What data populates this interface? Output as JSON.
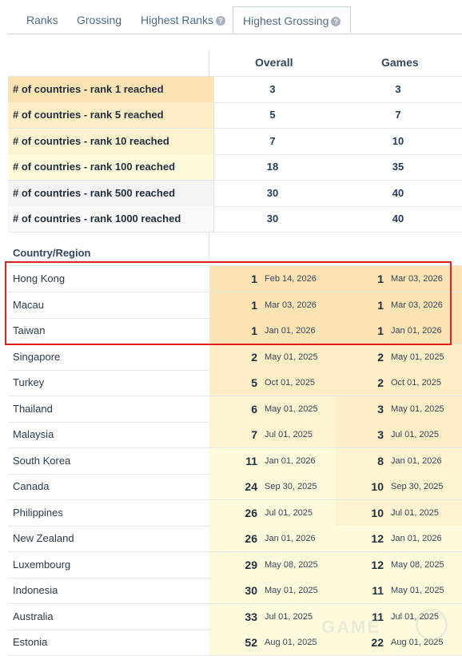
{
  "tabs": [
    {
      "label": "Ranks",
      "help": false,
      "active": false
    },
    {
      "label": "Grossing",
      "help": false,
      "active": false
    },
    {
      "label": "Highest Ranks",
      "help": true,
      "active": false
    },
    {
      "label": "Highest Grossing",
      "help": true,
      "active": true
    }
  ],
  "columns": {
    "overall": "Overall",
    "games": "Games"
  },
  "summary": [
    {
      "label": "# of countries - rank 1 reached",
      "overall": "3",
      "games": "3",
      "color": "#fce3b4"
    },
    {
      "label": "# of countries - rank 5 reached",
      "overall": "5",
      "games": "7",
      "color": "#fdeec6"
    },
    {
      "label": "# of countries - rank 10 reached",
      "overall": "7",
      "games": "10",
      "color": "#fdf3d0"
    },
    {
      "label": "# of countries - rank 100 reached",
      "overall": "18",
      "games": "35",
      "color": "#fefbdc"
    },
    {
      "label": "# of countries - rank 500 reached",
      "overall": "30",
      "games": "40",
      "color": "#f3f3f3"
    },
    {
      "label": "# of countries - rank 1000 reached",
      "overall": "30",
      "games": "40",
      "color": "#f9f9f9"
    }
  ],
  "section_label": "Country/Region",
  "countries": [
    {
      "name": "Hong Kong",
      "overall_rank": "1",
      "overall_date": "Feb 14, 2026",
      "games_rank": "1",
      "games_date": "Mar 03, 2026",
      "c1": "#fce3b4",
      "c2": "#fce3b4"
    },
    {
      "name": "Macau",
      "overall_rank": "1",
      "overall_date": "Mar 03, 2026",
      "games_rank": "1",
      "games_date": "Mar 03, 2026",
      "c1": "#fce3b4",
      "c2": "#fce3b4"
    },
    {
      "name": "Taiwan",
      "overall_rank": "1",
      "overall_date": "Jan 01, 2026",
      "games_rank": "1",
      "games_date": "Jan 01, 2026",
      "c1": "#fce3b4",
      "c2": "#fce3b4"
    },
    {
      "name": "Singapore",
      "overall_rank": "2",
      "overall_date": "May 01, 2025",
      "games_rank": "2",
      "games_date": "May 01, 2025",
      "c1": "#fdeec6",
      "c2": "#fdeec6"
    },
    {
      "name": "Turkey",
      "overall_rank": "5",
      "overall_date": "Oct 01, 2025",
      "games_rank": "2",
      "games_date": "Oct 01, 2025",
      "c1": "#fdeec6",
      "c2": "#fdeec6"
    },
    {
      "name": "Thailand",
      "overall_rank": "6",
      "overall_date": "May 01, 2025",
      "games_rank": "3",
      "games_date": "May 01, 2025",
      "c1": "#fdf3d0",
      "c2": "#fdeec6"
    },
    {
      "name": "Malaysia",
      "overall_rank": "7",
      "overall_date": "Jul 01, 2025",
      "games_rank": "3",
      "games_date": "Jul 01, 2025",
      "c1": "#fdf3d0",
      "c2": "#fdeec6"
    },
    {
      "name": "South Korea",
      "overall_rank": "11",
      "overall_date": "Jan 01, 2026",
      "games_rank": "8",
      "games_date": "Jan 01, 2026",
      "c1": "#fefbdc",
      "c2": "#fdf3d0"
    },
    {
      "name": "Canada",
      "overall_rank": "24",
      "overall_date": "Sep 30, 2025",
      "games_rank": "10",
      "games_date": "Sep 30, 2025",
      "c1": "#fefbdc",
      "c2": "#fdf3d0"
    },
    {
      "name": "Philippines",
      "overall_rank": "26",
      "overall_date": "Jul 01, 2025",
      "games_rank": "10",
      "games_date": "Jul 01, 2025",
      "c1": "#fefbdc",
      "c2": "#fdf3d0"
    },
    {
      "name": "New Zealand",
      "overall_rank": "26",
      "overall_date": "Jan 01, 2026",
      "games_rank": "12",
      "games_date": "Jan 01, 2026",
      "c1": "#fefbdc",
      "c2": "#fefbdc"
    },
    {
      "name": "Luxembourg",
      "overall_rank": "29",
      "overall_date": "May 08, 2025",
      "games_rank": "12",
      "games_date": "May 08, 2025",
      "c1": "#fefbdc",
      "c2": "#fefbdc"
    },
    {
      "name": "Indonesia",
      "overall_rank": "30",
      "overall_date": "May 01, 2025",
      "games_rank": "11",
      "games_date": "May 01, 2025",
      "c1": "#fefbdc",
      "c2": "#fefbdc"
    },
    {
      "name": "Australia",
      "overall_rank": "33",
      "overall_date": "Jul 01, 2025",
      "games_rank": "11",
      "games_date": "Jul 01, 2025",
      "c1": "#fefbdc",
      "c2": "#fefbdc"
    },
    {
      "name": "Estonia",
      "overall_rank": "52",
      "overall_date": "Aug 01, 2025",
      "games_rank": "22",
      "games_date": "Aug 01, 2025",
      "c1": "#fefbdc",
      "c2": "#fefbdc"
    }
  ],
  "highlight_color": "#e32020",
  "watermark": {
    "text": "GAME"
  }
}
